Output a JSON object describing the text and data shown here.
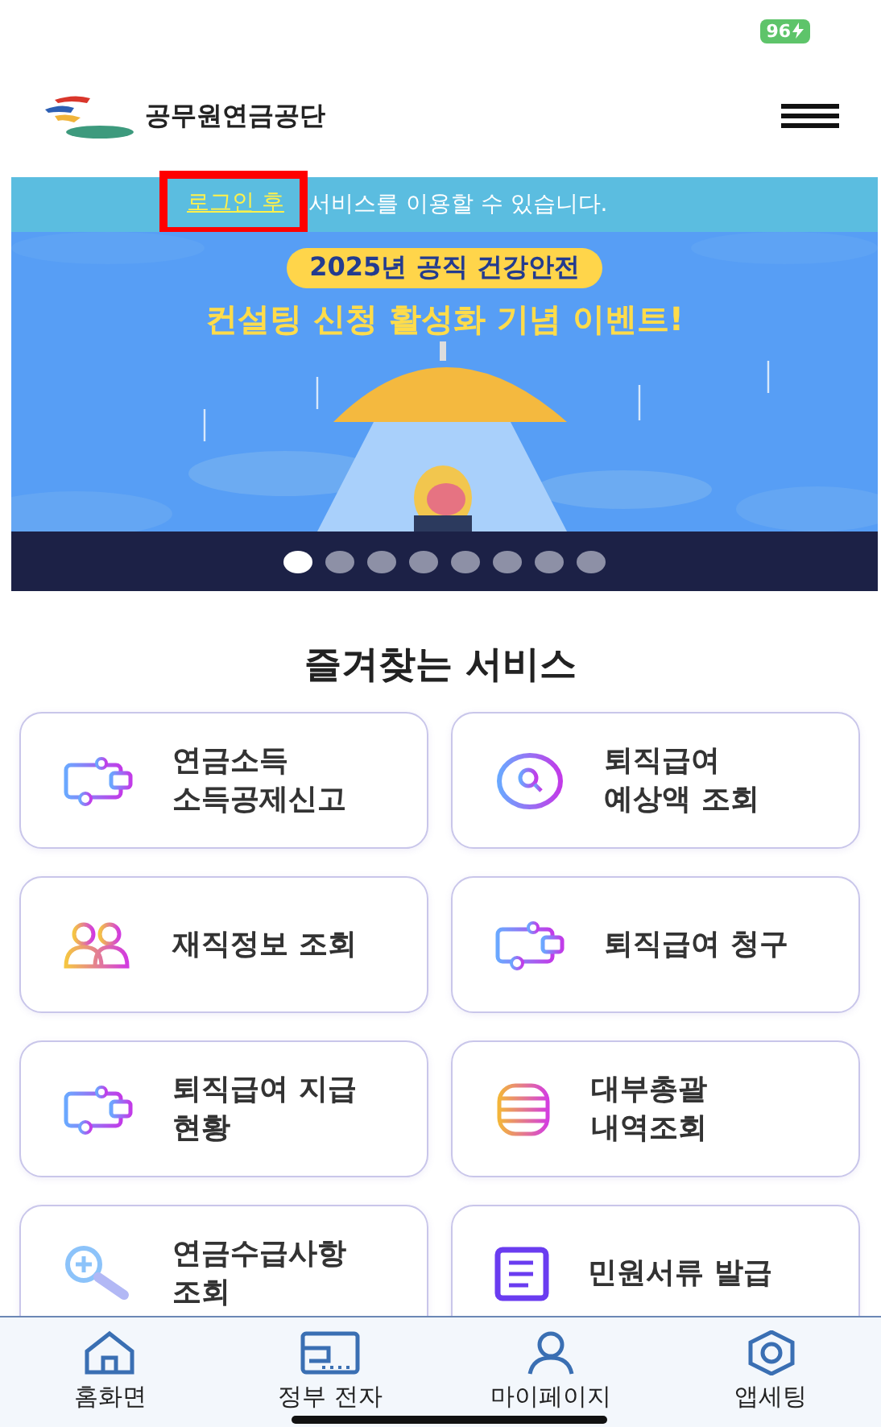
{
  "status_bar": {
    "battery": "96"
  },
  "header": {
    "logo_text": "공무원연금공단"
  },
  "notice": {
    "link": "로그인 후",
    "text": "서비스를 이용할 수 있습니다."
  },
  "banner": {
    "badge": "2025년 공직 건강안전",
    "headline": "컨설팅 신청 활성화 기념 이벤트!",
    "dots": [
      {
        "selected": true
      },
      {
        "selected": false
      },
      {
        "selected": false
      },
      {
        "selected": false
      },
      {
        "selected": false
      },
      {
        "selected": false
      },
      {
        "selected": false
      },
      {
        "selected": false
      }
    ]
  },
  "favorites": {
    "title": "즐겨찾는 서비스",
    "items": [
      {
        "kind": "wallet",
        "lines": [
          "연금소득",
          "소득공제신고"
        ]
      },
      {
        "kind": "search",
        "lines": [
          "퇴직급여",
          "예상액 조회"
        ]
      },
      {
        "kind": "people",
        "lines": [
          "재직정보 조회"
        ]
      },
      {
        "kind": "wallet",
        "lines": [
          "퇴직급여 청구"
        ]
      },
      {
        "kind": "wallet",
        "lines": [
          "퇴직급여 지급",
          "현황"
        ]
      },
      {
        "kind": "coins",
        "lines": [
          "대부총괄",
          "내역조회"
        ]
      },
      {
        "kind": "zoom",
        "lines": [
          "연금수급사항",
          "조회"
        ]
      },
      {
        "kind": "document",
        "lines": [
          "민원서류 발급"
        ]
      }
    ]
  },
  "bottom_nav": [
    {
      "kind": "home",
      "label": "홈화면"
    },
    {
      "kind": "wallet",
      "label": "정부 전자"
    },
    {
      "kind": "user",
      "label": "마이페이지"
    },
    {
      "kind": "hexagon",
      "label": "앱세팅"
    }
  ]
}
